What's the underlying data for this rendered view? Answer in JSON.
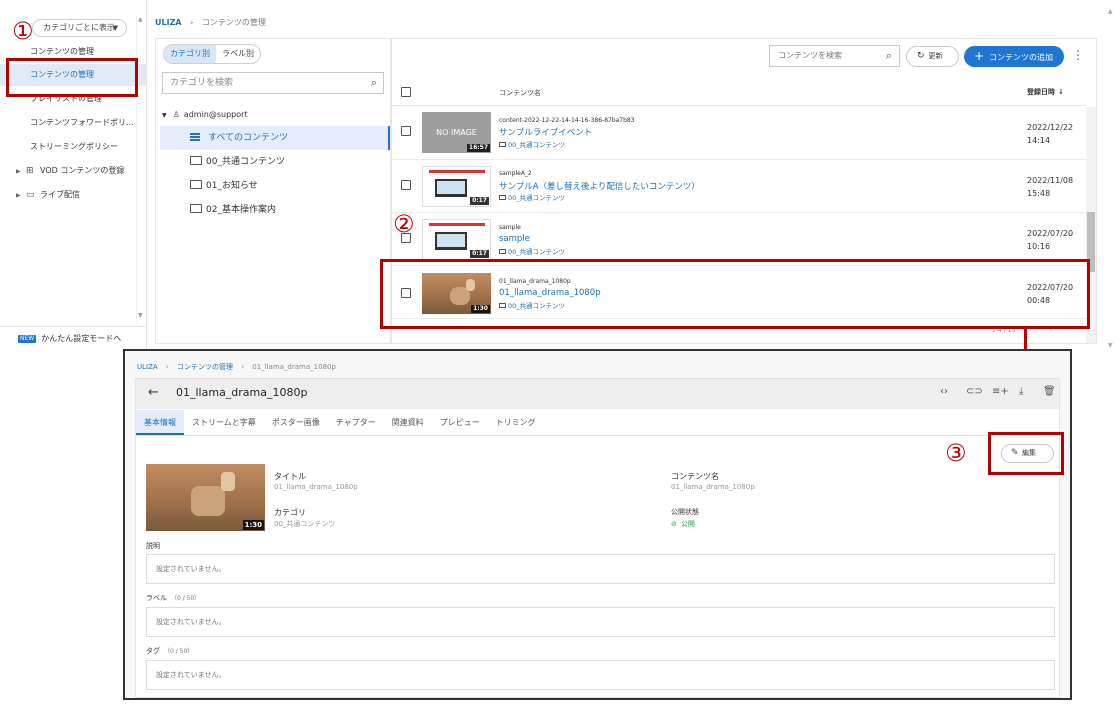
{
  "sidebar": {
    "view_select": "カテゴリごとに表示",
    "items": [
      "コンテンツの管理",
      "コンテンツの管理",
      "プレイリストの管理",
      "コンテンツフォワードポリ...",
      "ストリーミングポリシー"
    ],
    "groups": [
      "VOD コンテンツの登録",
      "ライブ配信"
    ],
    "easy_mode_badge": "NEW",
    "easy_mode_label": "かんたん設定モードへ"
  },
  "breadcrumb": {
    "root": "ULIZA",
    "separator": "›",
    "current": "コンテンツの管理"
  },
  "category_panel": {
    "tabs": [
      "カテゴリ別",
      "ラベル別"
    ],
    "search_placeholder": "カテゴリを検索",
    "root_user": "admin@support",
    "items": [
      "すべてのコンテンツ",
      "00_共通コンテンツ",
      "01_お知らせ",
      "02_基本操作案内"
    ]
  },
  "toolbar": {
    "search_placeholder": "コンテンツを検索",
    "refresh_label": "更新",
    "add_label": "コンテンツの追加"
  },
  "table": {
    "col_name": "コンテンツ名",
    "col_date": "登録日時",
    "rows": [
      {
        "id": "content-2022-12-22-14-14-16-386-87ba7b83",
        "title": "サンプルライブイベント",
        "category": "00_共通コンテンツ",
        "date": "2022/12/22",
        "time": "14:14",
        "duration": "16:57",
        "thumb_text": "NO IMAGE"
      },
      {
        "id": "sampleA_2",
        "title": "サンプルA（差し替え後より配信したいコンテンツ）",
        "category": "00_共通コンテンツ",
        "date": "2022/11/08",
        "time": "15:48",
        "duration": "0:17"
      },
      {
        "id": "sample",
        "title": "sample",
        "category": "00_共通コンテンツ",
        "date": "2022/07/20",
        "time": "10:16",
        "duration": "0:17"
      },
      {
        "id": "01_llama_drama_1080p",
        "title": "01_llama_drama_1080p",
        "category": "00_共通コンテンツ",
        "date": "2022/07/20",
        "time": "00:48",
        "duration": "1:30"
      }
    ],
    "pagination": "1-4 / 13"
  },
  "markers": [
    "①",
    "②",
    "③"
  ],
  "detail": {
    "breadcrumb": {
      "root": "ULIZA",
      "mid": "コンテンツの管理",
      "current": "01_llama_drama_1080p"
    },
    "title": "01_llama_drama_1080p",
    "tabs": [
      "基本情報",
      "ストリームと字幕",
      "ポスター画像",
      "チャプター",
      "関連資料",
      "プレビュー",
      "トリミング"
    ],
    "edit_label": "編集",
    "thumb_duration": "1:30",
    "fields": {
      "title_label": "タイトル",
      "title_value": "01_llama_drama_1080p",
      "name_label": "コンテンツ名",
      "name_value": "01_llama_drama_1080p",
      "category_label": "カテゴリ",
      "category_value": "00_共通コンテンツ",
      "status_label": "公開状態",
      "status_value": "公開"
    },
    "description_label": "説明",
    "description_value": "設定されていません。",
    "label_label": "ラベル",
    "label_count": "（0 / 50）",
    "label_value": "設定されていません。",
    "tag_label": "タグ",
    "tag_count": "（0 / 50）",
    "tag_value": "設定されていません。"
  },
  "colors": {
    "accent": "#1f75d0",
    "highlight": "#b30000",
    "marker": "#c00000",
    "public": "#1e9e4a"
  }
}
